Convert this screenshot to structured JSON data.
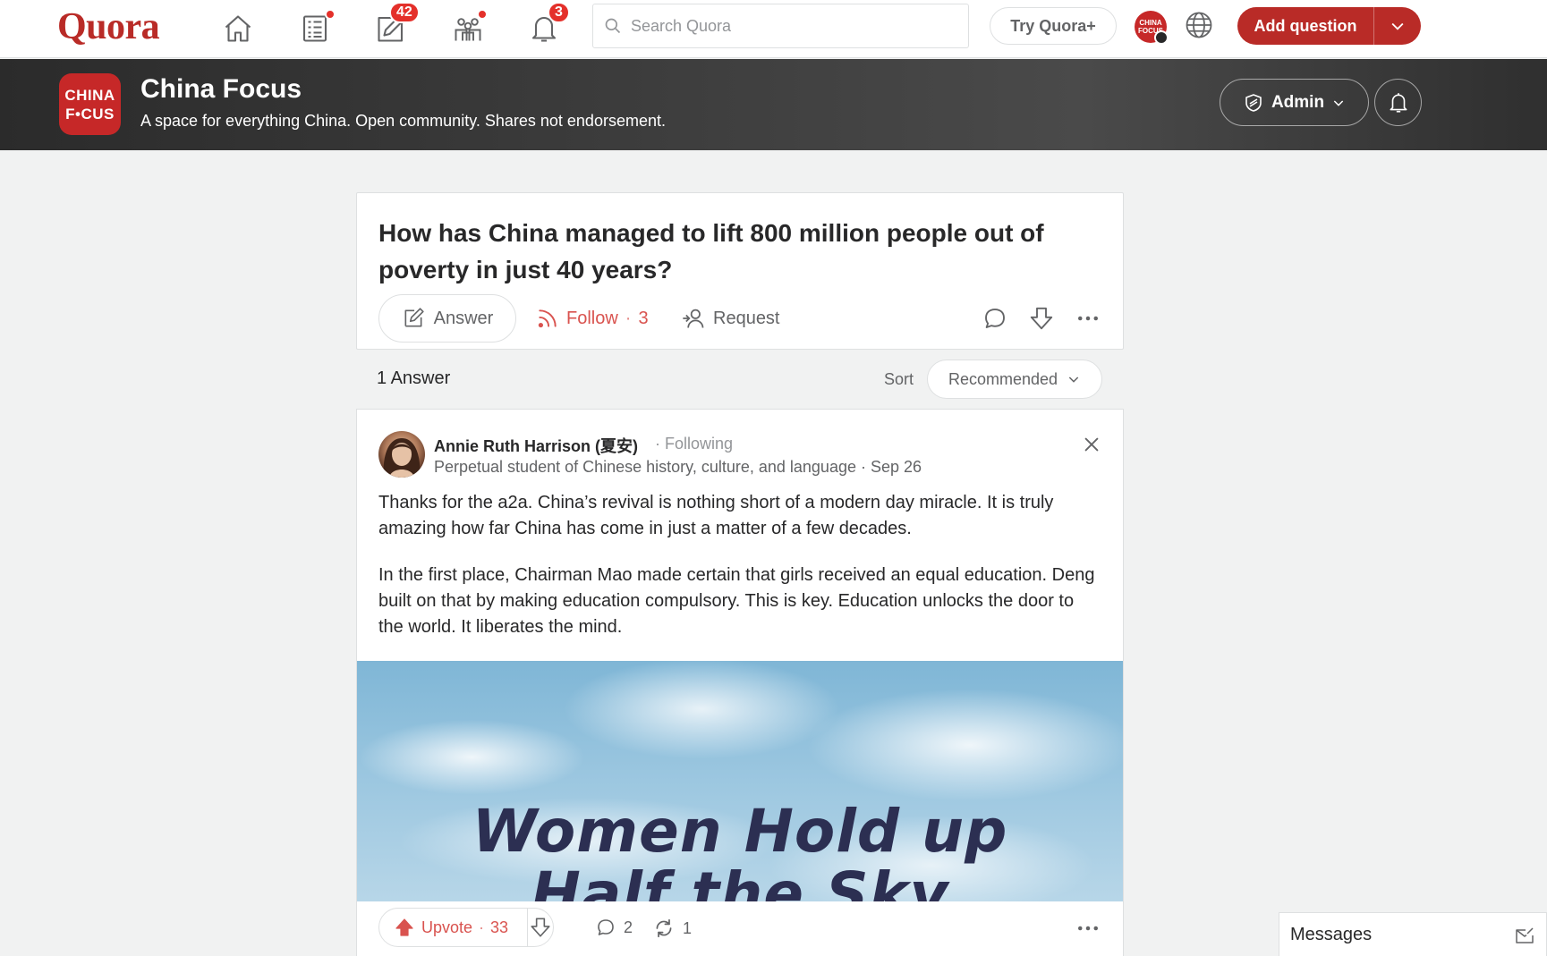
{
  "nav": {
    "logo": "Quora",
    "answer_badge": "42",
    "notif_badge": "3",
    "search_placeholder": "Search Quora",
    "try_plus": "Try Quora+",
    "account_initials": "CHINA FOCUS",
    "add_question": "Add question"
  },
  "space": {
    "logo_line1": "CHINA",
    "logo_line2": "F•CUS",
    "title": "China Focus",
    "description": "A space for everything China. Open community. Shares not endorsement.",
    "admin_label": "Admin"
  },
  "question": {
    "title": "How has China managed to lift 800 million people out of poverty in just 40 years?",
    "answer_label": "Answer",
    "follow_label": "Follow",
    "follow_count": "3",
    "request_label": "Request"
  },
  "answers_header": {
    "count_label": "1 Answer",
    "sort_label": "Sort",
    "sort_value": "Recommended"
  },
  "answer": {
    "author": "Annie Ruth Harrison (夏安)",
    "following": "· Following",
    "credential": "Perpetual student of Chinese history, culture, and language · Sep 26",
    "paragraph1": "Thanks for the a2a. China’s revival is nothing short of a modern day miracle. It is truly amazing how far China has come in just a matter of a few decades.",
    "paragraph2": "In the first place, Chairman Mao made certain that girls received an equal education. Deng built on that by making education compulsory. This is key. Education unlocks the door to the world. It liberates the mind.",
    "image_line1": "Women Hold up",
    "image_line2": "Half the Sky",
    "upvote_label": "Upvote",
    "upvote_count": "33",
    "comment_count": "2",
    "share_count": "1"
  },
  "messages": {
    "label": "Messages"
  },
  "colors": {
    "brand": "#b92b27",
    "accent_red": "#d9534f",
    "text": "#282829",
    "muted": "#636466",
    "border": "#dee0e1",
    "page_bg": "#f1f2f2"
  },
  "icons": [
    "home-icon",
    "following-feed-icon",
    "answer-icon",
    "spaces-icon",
    "bell-icon",
    "search-icon",
    "globe-icon",
    "chevron-down-icon",
    "shield-icon",
    "pencil-icon",
    "follow-rss-icon",
    "request-person-icon",
    "comment-icon",
    "downvote-icon",
    "more-icon",
    "close-icon",
    "upvote-icon",
    "share-icon",
    "compose-message-icon"
  ]
}
